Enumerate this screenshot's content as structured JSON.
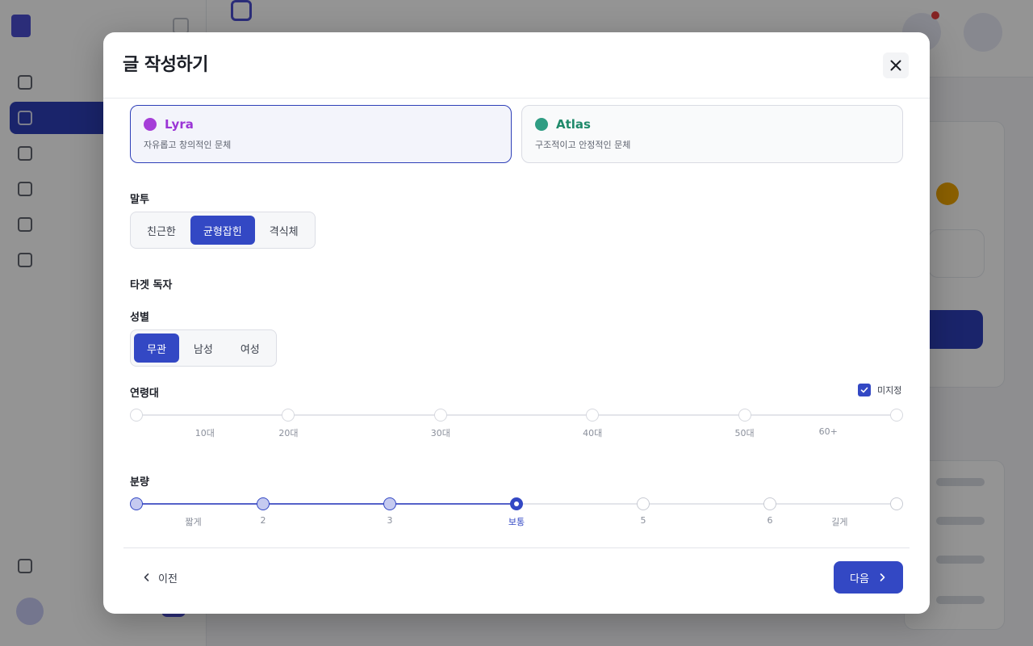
{
  "modal": {
    "title": "글 작성하기",
    "close_icon": "close-icon"
  },
  "personas": [
    {
      "name": "Lyra",
      "desc": "자유롭고 창의적인 문체",
      "color": "#9b35d6",
      "dot_color": "#a53ed8",
      "selected": true
    },
    {
      "name": "Atlas",
      "desc": "구조적이고 안정적인 문체",
      "color": "#1f8a6a",
      "dot_color": "#2f9d83",
      "selected": false
    }
  ],
  "tone": {
    "label": "말투",
    "options": [
      "친근한",
      "균형잡힌",
      "격식체"
    ],
    "selected": "균형잡힌"
  },
  "target_reader": {
    "label": "타겟 독자"
  },
  "gender": {
    "label": "성별",
    "options": [
      "무관",
      "남성",
      "여성"
    ],
    "selected": "무관"
  },
  "age": {
    "label": "연령대",
    "unspecified_label": "미지정",
    "unspecified_checked": true,
    "ticks": [
      "10대",
      "20대",
      "30대",
      "40대",
      "50대",
      "60+"
    ]
  },
  "length": {
    "label": "분량",
    "ticks": [
      "짧게",
      "2",
      "3",
      "보통",
      "5",
      "6",
      "길게"
    ],
    "selected": "보통"
  },
  "footer": {
    "prev_label": "이전",
    "next_label": "다음"
  },
  "colors": {
    "accent": "#3348c4",
    "overlay": "rgba(0,0,0,0.42)"
  }
}
